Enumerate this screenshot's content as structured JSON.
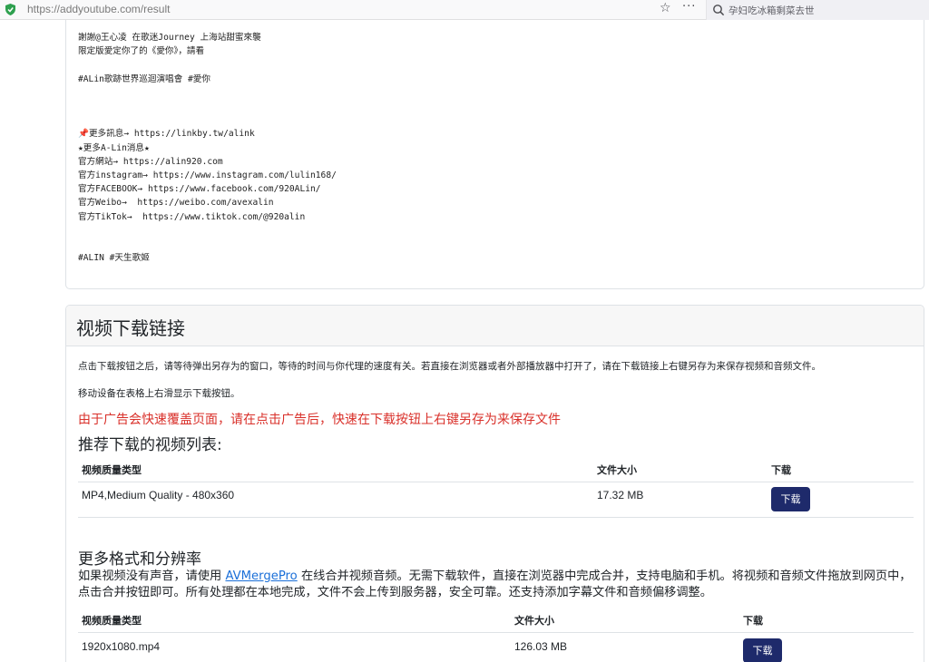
{
  "browser": {
    "url_scheme": "https://",
    "url_host": "addyoutube.com",
    "url_path": "/result",
    "star_glyph": "☆",
    "menu_glyph": "···",
    "search_text": "孕妇吃冰箱剩菜去世"
  },
  "description": {
    "lines": [
      "謝謝@王心凌 在歌迷Journey 上海站甜蜜來襲",
      "限定版愛定你了的《愛你》，請看",
      "",
      "#ALin歌跡世界巡迴演唱會 #愛你",
      "",
      "",
      "",
      "更多訊息→ https://linkby.tw/alink",
      "★更多A-Lin消息★",
      "官方網站→ https://alin920.com",
      "官方instagram→ https://www.instagram.com/lulin168/",
      "官方FACEBOOK→ https://www.facebook.com/920ALin/",
      "官方Weibo→  https://weibo.com/avexalin",
      "官方TikTok→  https://www.tiktok.com/@920alin",
      "",
      "",
      "#ALIN #天生歌姬"
    ],
    "pin_glyph": "📌"
  },
  "download": {
    "title": "视频下载链接",
    "instructions": "点击下载按钮之后，请等待弹出另存为的窗口，等待的时间与你代理的速度有关。若直接在浏览器或者外部播放器中打开了，请在下载链接上右键另存为来保存视频和音频文件。",
    "mobile_hint": "移动设备在表格上右滑显示下载按钮。",
    "warning": "由于广告会快速覆盖页面，请在点击广告后，快速在下载按钮上右键另存为来保存文件",
    "recommended_title": "推荐下载的视频列表:",
    "table_headers": {
      "quality": "视频质量类型",
      "size": "文件大小",
      "download": "下载"
    },
    "recommended_rows": [
      {
        "quality": "MP4,Medium Quality - 480x360",
        "size": "17.32 MB",
        "button": "下载"
      }
    ],
    "more_title": "更多格式和分辨率",
    "more_text_before": "如果视频没有声音，请使用 ",
    "more_link": "AVMergePro",
    "more_text_after": " 在线合并视频音频。无需下载软件，直接在浏览器中完成合并，支持电脑和手机。将视频和音频文件拖放到网页中，点击合并按钮即可。所有处理都在本地完成，文件不会上传到服务器，安全可靠。还支持添加字幕文件和音频偏移调整。",
    "more_rows": [
      {
        "quality": "1920x1080.mp4",
        "size": "126.03 MB",
        "button": "下载"
      }
    ]
  },
  "colors": {
    "button": "#1e2a6b",
    "warning": "#d9302a",
    "link": "#1a6fd8",
    "shield": "#2ea04f"
  }
}
